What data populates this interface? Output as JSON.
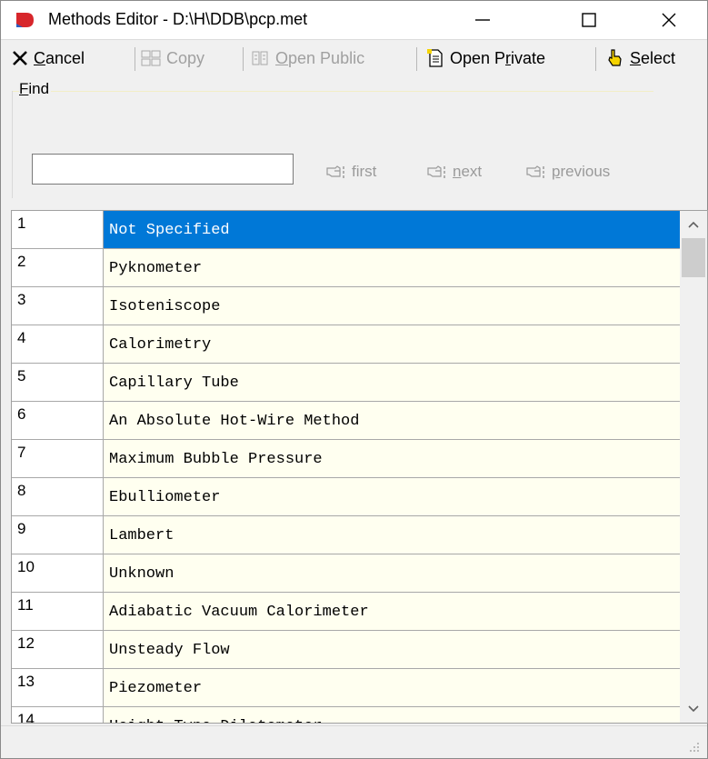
{
  "window": {
    "title": "Methods Editor - D:\\H\\DDB\\pcp.met"
  },
  "toolbar": {
    "cancel": {
      "prefix": "",
      "mnemonic": "C",
      "rest": "ancel"
    },
    "copy": {
      "label": "Copy"
    },
    "open_public": {
      "prefix": "",
      "mnemonic": "O",
      "rest": "pen Public"
    },
    "open_private": {
      "prefix": "Open P",
      "mnemonic": "r",
      "rest": "ivate"
    },
    "select": {
      "prefix": "",
      "mnemonic": "S",
      "rest": "elect"
    }
  },
  "find": {
    "label_mnemonic": "F",
    "label_rest": "ind",
    "value": "",
    "first": "first",
    "next_mnemonic": "n",
    "next_rest": "ext",
    "previous_mnemonic": "p",
    "previous_rest": "revious"
  },
  "methods": [
    {
      "id": "1",
      "name": "Not Specified",
      "selected": true
    },
    {
      "id": "2",
      "name": "Pyknometer"
    },
    {
      "id": "3",
      "name": "Isoteniscope"
    },
    {
      "id": "4",
      "name": "Calorimetry"
    },
    {
      "id": "5",
      "name": "Capillary Tube"
    },
    {
      "id": "6",
      "name": "An Absolute Hot-Wire Method"
    },
    {
      "id": "7",
      "name": "Maximum Bubble Pressure"
    },
    {
      "id": "8",
      "name": "Ebulliometer"
    },
    {
      "id": "9",
      "name": "Lambert"
    },
    {
      "id": "10",
      "name": "Unknown"
    },
    {
      "id": "11",
      "name": "Adiabatic Vacuum Calorimeter"
    },
    {
      "id": "12",
      "name": "Unsteady Flow"
    },
    {
      "id": "13",
      "name": "Piezometer"
    },
    {
      "id": "14",
      "name": "Height-Type Dilatometer"
    }
  ],
  "colors": {
    "selection": "#0078d7",
    "cell_background": "#fffff0",
    "app_icon_red": "#d7262b",
    "app_icon_blue": "#2e5fbf"
  },
  "icons": {
    "app": "app-logo-icon",
    "cancel": "x-icon",
    "copy": "copy-icon",
    "open_public": "public-folder-icon",
    "open_private": "document-icon",
    "select": "hand-pointer-icon",
    "find_buttons": "pointing-hand-icon"
  }
}
